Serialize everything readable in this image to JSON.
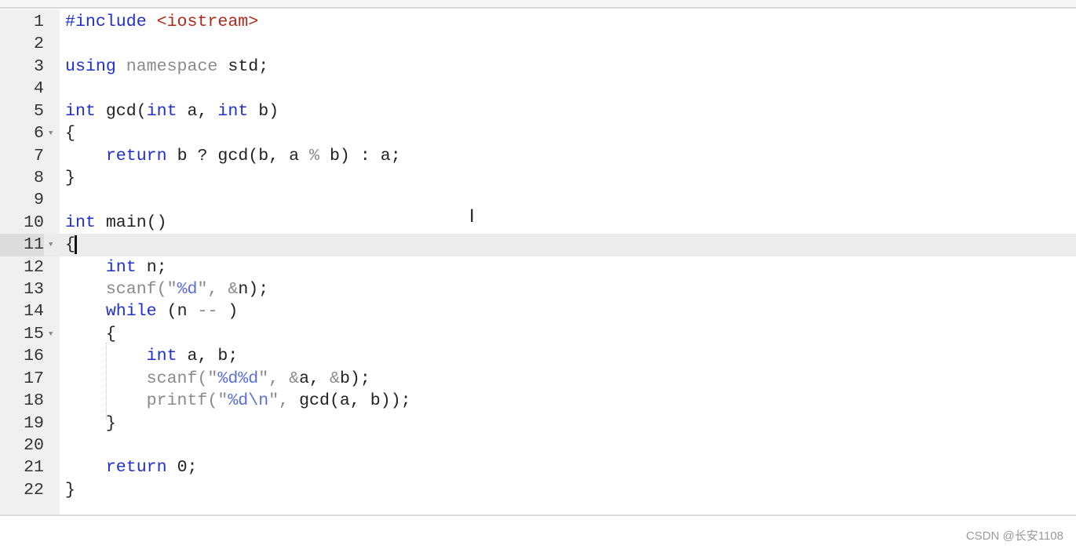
{
  "editor": {
    "active_line": 11,
    "fold_lines": [
      6,
      11,
      15
    ],
    "lines": [
      [
        [
          "#include ",
          "kw"
        ],
        [
          "<iostream>",
          "inc"
        ]
      ],
      [],
      [
        [
          "using ",
          "kw"
        ],
        [
          "namespace ",
          "ns"
        ],
        [
          "std;",
          ""
        ]
      ],
      [],
      [
        [
          "int ",
          "kw"
        ],
        [
          "gcd(",
          ""
        ],
        [
          "int ",
          "kw"
        ],
        [
          "a, ",
          ""
        ],
        [
          "int ",
          "kw"
        ],
        [
          "b)",
          ""
        ]
      ],
      [
        [
          "{",
          ""
        ]
      ],
      [
        [
          "    ",
          ""
        ],
        [
          "return ",
          "kw"
        ],
        [
          "b ? gcd(b, a ",
          ""
        ],
        [
          "%",
          "op"
        ],
        [
          " b) : a;",
          ""
        ]
      ],
      [
        [
          "}",
          ""
        ]
      ],
      [],
      [
        [
          "int ",
          "kw"
        ],
        [
          "main()",
          ""
        ]
      ],
      [
        [
          "{",
          ""
        ]
      ],
      [
        [
          "    ",
          ""
        ],
        [
          "int ",
          "kw"
        ],
        [
          "n;",
          ""
        ]
      ],
      [
        [
          "    ",
          ""
        ],
        [
          "scanf(\"",
          "op"
        ],
        [
          "%d",
          "str"
        ],
        [
          "\", ",
          "op"
        ],
        [
          "&",
          "op"
        ],
        [
          "n);",
          ""
        ]
      ],
      [
        [
          "    ",
          ""
        ],
        [
          "while ",
          "kw"
        ],
        [
          "(n ",
          ""
        ],
        [
          "-- ",
          "op"
        ],
        [
          ")",
          ""
        ]
      ],
      [
        [
          "    {",
          ""
        ]
      ],
      [
        [
          "        ",
          ""
        ],
        [
          "int ",
          "kw"
        ],
        [
          "a, b;",
          ""
        ]
      ],
      [
        [
          "        ",
          ""
        ],
        [
          "scanf(\"",
          "op"
        ],
        [
          "%d%d",
          "str"
        ],
        [
          "\", ",
          "op"
        ],
        [
          "&",
          "op"
        ],
        [
          "a, ",
          ""
        ],
        [
          "&",
          "op"
        ],
        [
          "b);",
          ""
        ]
      ],
      [
        [
          "        ",
          ""
        ],
        [
          "printf(\"",
          "op"
        ],
        [
          "%d\\n",
          "str"
        ],
        [
          "\", ",
          "op"
        ],
        [
          "gcd(a, b));",
          ""
        ]
      ],
      [
        [
          "    }",
          ""
        ]
      ],
      [],
      [
        [
          "    ",
          ""
        ],
        [
          "return ",
          "kw"
        ],
        [
          "0;",
          ""
        ]
      ],
      [
        [
          "}",
          ""
        ]
      ]
    ]
  },
  "watermark": "CSDN @长安1108",
  "colors": {
    "keyword": "#1f2fd0",
    "include": "#b02a1a",
    "string": "#5a6fd8",
    "gutter": "#f0f0f0",
    "active_line": "#ececec"
  }
}
